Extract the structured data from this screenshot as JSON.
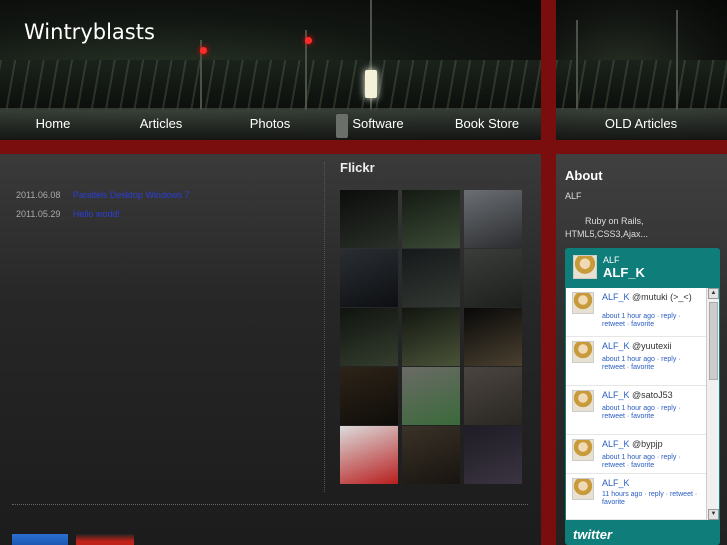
{
  "site": {
    "title": "Wintryblasts"
  },
  "nav": [
    {
      "label": "Home"
    },
    {
      "label": "Articles"
    },
    {
      "label": "Photos"
    },
    {
      "label": "Software"
    },
    {
      "label": "Book Store"
    },
    {
      "label": "OLD Articles"
    }
  ],
  "posts": [
    {
      "date": "2011.06.08",
      "title": "Parallels Desktop Windows 7"
    },
    {
      "date": "2011.05.29",
      "title": "Hello world!"
    }
  ],
  "flickr": {
    "heading": "Flickr",
    "thumbs": [
      {
        "colors": [
          "#0b0d0b",
          "#2a2f28"
        ]
      },
      {
        "colors": [
          "#141a13",
          "#3b4a36"
        ]
      },
      {
        "colors": [
          "#6b6e72",
          "#2a2c30"
        ]
      },
      {
        "colors": [
          "#2a2e33",
          "#0d0f12"
        ]
      },
      {
        "colors": [
          "#16191a",
          "#323833"
        ]
      },
      {
        "colors": [
          "#3a3d3a",
          "#1e201e"
        ]
      },
      {
        "colors": [
          "#101410",
          "#343d2e"
        ]
      },
      {
        "colors": [
          "#121610",
          "#4a5238"
        ]
      },
      {
        "colors": [
          "#080808",
          "#4a4030"
        ]
      },
      {
        "colors": [
          "#2e2418",
          "#0e0c0a"
        ]
      },
      {
        "colors": [
          "#6b6a66",
          "#3a6a3a"
        ]
      },
      {
        "colors": [
          "#4a4540",
          "#2a2622"
        ]
      },
      {
        "colors": [
          "#dcdcdc",
          "#b81e1e"
        ]
      },
      {
        "colors": [
          "#3a3228",
          "#181410"
        ]
      },
      {
        "colors": [
          "#1e1c24",
          "#3a3440"
        ]
      }
    ]
  },
  "about": {
    "heading": "About",
    "name": "ALF",
    "description": "Ruby on Rails, HTML5,CSS3,Ajax..."
  },
  "twitter": {
    "display_name": "ALF",
    "username": "ALF_K",
    "tweets": [
      {
        "user": "ALF_K",
        "text": "@mutuki (>_<)",
        "meta": "about 1 hour ago · reply · retweet · favorite"
      },
      {
        "user": "ALF_K",
        "text": "@yuutexii",
        "meta": "about 1 hour ago · reply · retweet · favorite"
      },
      {
        "user": "ALF_K",
        "text": "@satoJ53",
        "meta": "about 1 hour ago · reply · retweet · favorite"
      },
      {
        "user": "ALF_K",
        "text": "@bypjp",
        "meta": "about 1 hour ago · reply · retweet · favorite"
      },
      {
        "user": "ALF_K",
        "text": "",
        "meta": "11 hours ago · reply · retweet · favorite"
      }
    ],
    "logo": "twitter"
  },
  "colors": {
    "accent_red": "#7a0d0d",
    "twitter_teal": "#0f7d7a",
    "link_blue": "#2b3fd9"
  }
}
